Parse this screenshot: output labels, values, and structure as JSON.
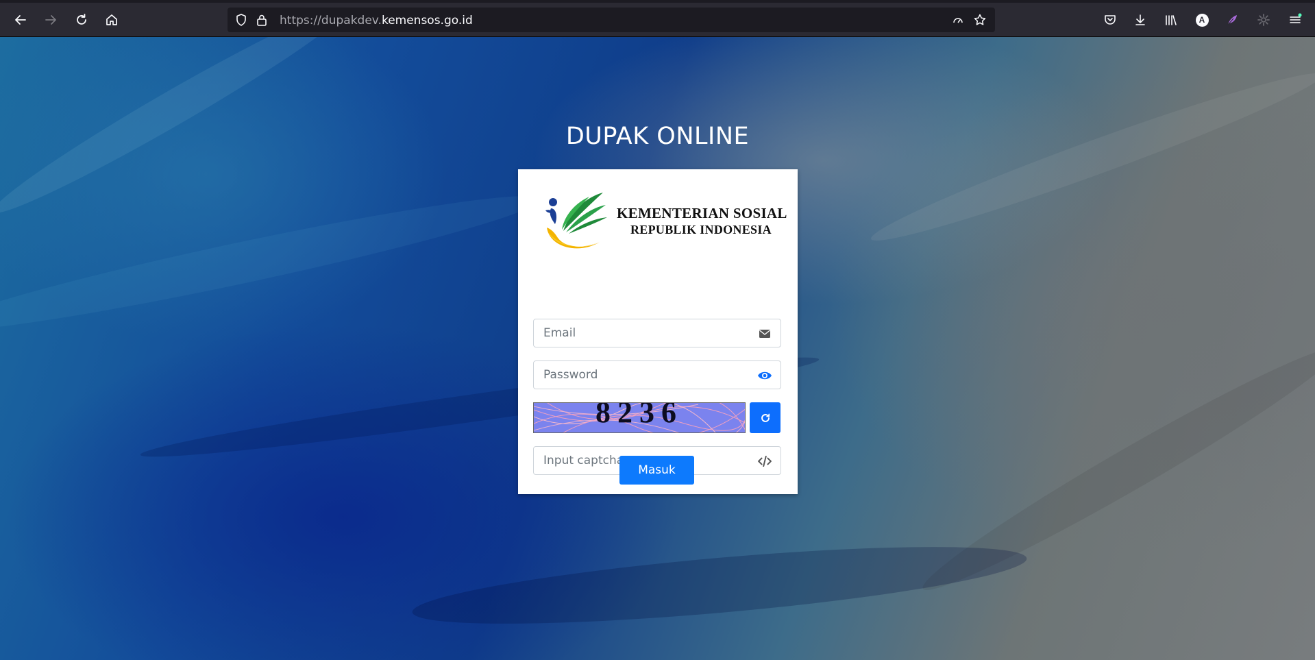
{
  "browser": {
    "url_prefix": "https://dupakdev.",
    "url_domain": "kemensos.go.id",
    "avatar_letter": "A"
  },
  "page": {
    "title": "DUPAK ONLINE",
    "logo": {
      "line1": "KEMENTERIAN SOSIAL",
      "line2": "REPUBLIK INDONESIA"
    },
    "email_placeholder": "Email",
    "password_placeholder": "Password",
    "captcha_code": "8236",
    "captcha_placeholder": "Input captcha",
    "submit_label": "Masuk"
  },
  "colors": {
    "primary": "#0d6efd",
    "browser_toolbar": "#2b2a33",
    "urlbar": "#1c1b22"
  },
  "icons": {
    "back": "arrow-left-icon",
    "forward": "arrow-right-icon",
    "reload": "reload-icon",
    "home": "home-icon",
    "shield": "shield-icon",
    "lock": "lock-icon",
    "reader": "reader-mode-icon",
    "bookmark": "star-icon",
    "pocket": "pocket-icon",
    "downloads": "download-icon",
    "library": "library-icon",
    "account": "account-icon",
    "extension": "feather-icon",
    "settings": "gear-icon",
    "menu": "hamburger-menu-icon",
    "email": "envelope-icon",
    "password": "eye-icon",
    "refresh": "refresh-icon",
    "captcha": "code-icon"
  }
}
